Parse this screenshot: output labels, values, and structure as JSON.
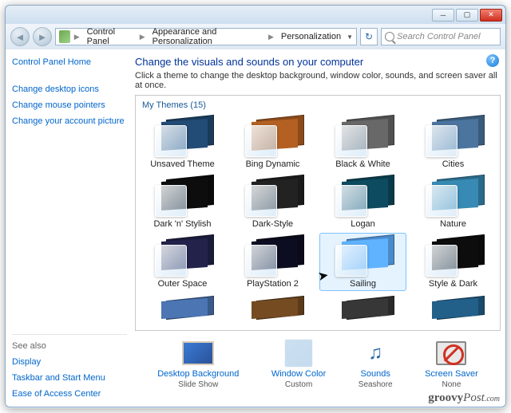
{
  "breadcrumbs": [
    "Control Panel",
    "Appearance and Personalization",
    "Personalization"
  ],
  "search_placeholder": "Search Control Panel",
  "sidebar": {
    "home": "Control Panel Home",
    "links": [
      "Change desktop icons",
      "Change mouse pointers",
      "Change your account picture"
    ],
    "seealso_label": "See also",
    "seealso": [
      "Display",
      "Taskbar and Start Menu",
      "Ease of Access Center"
    ]
  },
  "main": {
    "heading": "Change the visuals and sounds on your computer",
    "desc": "Click a theme to change the desktop background, window color, sounds, and screen saver all at once.",
    "group_label": "My Themes (15)",
    "themes": [
      {
        "name": "Unsaved Theme",
        "bg": "#1a3a5a"
      },
      {
        "name": "Bing Dynamic",
        "bg": "#8a4a1a"
      },
      {
        "name": "Black & White",
        "bg": "#505050"
      },
      {
        "name": "Cities",
        "bg": "#3a5a7a"
      },
      {
        "name": "Dark 'n' Stylish",
        "bg": "#0a0a0a"
      },
      {
        "name": "Dark-Style",
        "bg": "#1a1a1a"
      },
      {
        "name": "Logan",
        "bg": "#0a3a4a"
      },
      {
        "name": "Nature",
        "bg": "#2a6a8a"
      },
      {
        "name": "Outer Space",
        "bg": "#1a1a3a"
      },
      {
        "name": "PlayStation 2",
        "bg": "#0a0a1a"
      },
      {
        "name": "Sailing",
        "bg": "#4a8aca",
        "selected": true
      },
      {
        "name": "Style & Dark",
        "bg": "#0a0a0a"
      }
    ],
    "peek_themes": [
      {
        "bg": "#3a5a8a"
      },
      {
        "bg": "#5a3a1a"
      },
      {
        "bg": "#2a2a2a"
      },
      {
        "bg": "#1a4a6a"
      }
    ]
  },
  "bottom": [
    {
      "label": "Desktop Background",
      "sub": "Slide Show"
    },
    {
      "label": "Window Color",
      "sub": "Custom"
    },
    {
      "label": "Sounds",
      "sub": "Seashore"
    },
    {
      "label": "Screen Saver",
      "sub": "None"
    }
  ],
  "watermark": "groovyPost.com"
}
